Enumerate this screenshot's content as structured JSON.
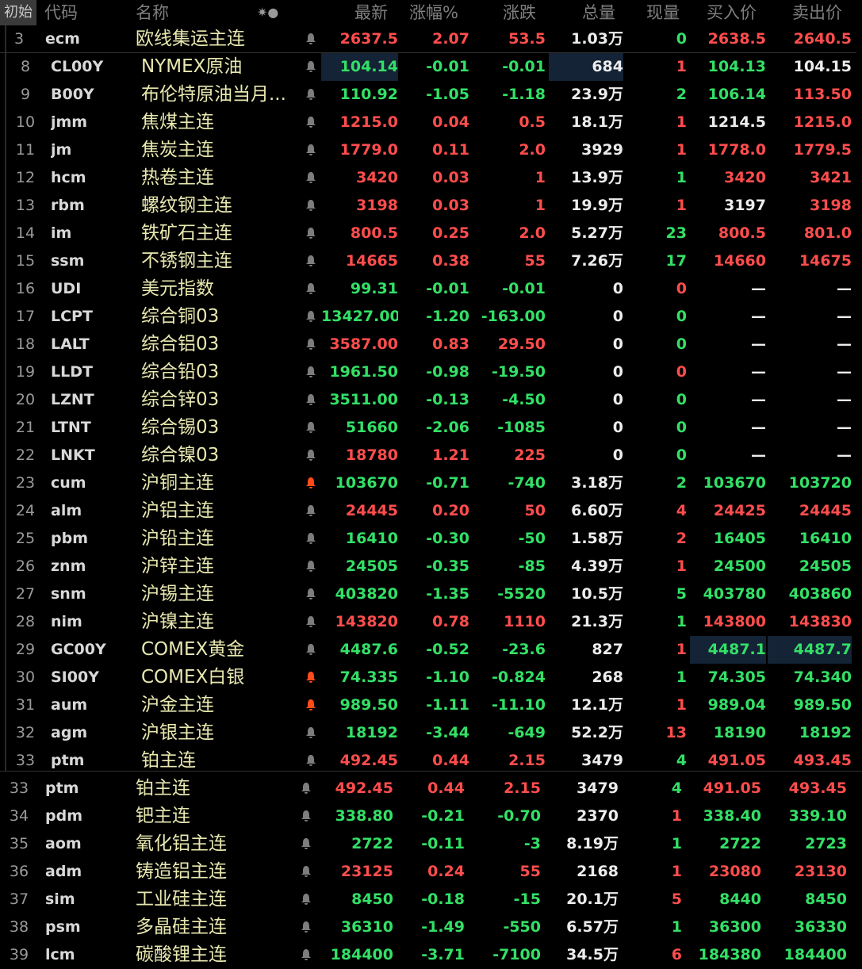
{
  "header": {
    "init": "初始",
    "code": "代码",
    "name": "名称",
    "settings": "✷●",
    "last": "最新",
    "pct": "涨幅%",
    "chg": "涨跌",
    "vol": "总量",
    "cur": "现量",
    "bid": "买入价",
    "ask": "卖出价"
  },
  "colors": {
    "up": "#ff4d4d",
    "down": "#33e066",
    "name": "#e8e8b0",
    "alert": "#ff4b1a",
    "highlight": "#142335"
  },
  "rows": [
    {
      "idx": "3",
      "code": "ecm",
      "name": "欧线集运主连",
      "last": "2637.5",
      "pct": "2.07",
      "chg": "53.5",
      "vol": "1.03万",
      "cur": "0",
      "bid": "2638.5",
      "ask": "2640.5",
      "trend": "up",
      "curColor": "green",
      "bidColor": "red",
      "askColor": "red",
      "bell": "normal"
    },
    {
      "idx": "8",
      "code": "CL00Y",
      "name": "NYMEX原油",
      "last": "104.14",
      "pct": "-0.01",
      "chg": "-0.01",
      "vol": "684",
      "cur": "1",
      "bid": "104.13",
      "ask": "104.15",
      "trend": "down",
      "curColor": "red",
      "bidColor": "green",
      "askColor": "white",
      "bell": "normal"
    },
    {
      "idx": "9",
      "code": "B00Y",
      "name": "布伦特原油当月...",
      "last": "110.92",
      "pct": "-1.05",
      "chg": "-1.18",
      "vol": "23.9万",
      "cur": "2",
      "bid": "106.14",
      "ask": "113.50",
      "trend": "down",
      "curColor": "green",
      "bidColor": "green",
      "askColor": "red",
      "bell": "normal"
    },
    {
      "idx": "10",
      "code": "jmm",
      "name": "焦煤主连",
      "last": "1215.0",
      "pct": "0.04",
      "chg": "0.5",
      "vol": "18.1万",
      "cur": "1",
      "bid": "1214.5",
      "ask": "1215.0",
      "trend": "up",
      "curColor": "red",
      "bidColor": "white",
      "askColor": "red",
      "bell": "normal"
    },
    {
      "idx": "11",
      "code": "jm",
      "name": "焦炭主连",
      "last": "1779.0",
      "pct": "0.11",
      "chg": "2.0",
      "vol": "3929",
      "cur": "1",
      "bid": "1778.0",
      "ask": "1779.5",
      "trend": "up",
      "curColor": "red",
      "bidColor": "red",
      "askColor": "red",
      "bell": "normal"
    },
    {
      "idx": "12",
      "code": "hcm",
      "name": "热卷主连",
      "last": "3420",
      "pct": "0.03",
      "chg": "1",
      "vol": "13.9万",
      "cur": "1",
      "bid": "3420",
      "ask": "3421",
      "trend": "up",
      "curColor": "green",
      "bidColor": "red",
      "askColor": "red",
      "bell": "normal"
    },
    {
      "idx": "13",
      "code": "rbm",
      "name": "螺纹钢主连",
      "last": "3198",
      "pct": "0.03",
      "chg": "1",
      "vol": "19.9万",
      "cur": "1",
      "bid": "3197",
      "ask": "3198",
      "trend": "up",
      "curColor": "red",
      "bidColor": "white",
      "askColor": "red",
      "bell": "normal"
    },
    {
      "idx": "14",
      "code": "im",
      "name": "铁矿石主连",
      "last": "800.5",
      "pct": "0.25",
      "chg": "2.0",
      "vol": "5.27万",
      "cur": "23",
      "bid": "800.5",
      "ask": "801.0",
      "trend": "up",
      "curColor": "green",
      "bidColor": "red",
      "askColor": "red",
      "bell": "normal"
    },
    {
      "idx": "15",
      "code": "ssm",
      "name": "不锈钢主连",
      "last": "14665",
      "pct": "0.38",
      "chg": "55",
      "vol": "7.26万",
      "cur": "17",
      "bid": "14660",
      "ask": "14675",
      "trend": "up",
      "curColor": "green",
      "bidColor": "red",
      "askColor": "red",
      "bell": "normal"
    },
    {
      "idx": "16",
      "code": "UDI",
      "name": "美元指数",
      "last": "99.31",
      "pct": "-0.01",
      "chg": "-0.01",
      "vol": "0",
      "cur": "0",
      "bid": "—",
      "ask": "—",
      "trend": "down",
      "curColor": "red",
      "bidColor": "white",
      "askColor": "white",
      "bell": "normal"
    },
    {
      "idx": "17",
      "code": "LCPT",
      "name": "综合铜03",
      "last": "13427.00",
      "pct": "-1.20",
      "chg": "-163.00",
      "vol": "0",
      "cur": "0",
      "bid": "—",
      "ask": "—",
      "trend": "down",
      "curColor": "green",
      "bidColor": "white",
      "askColor": "white",
      "bell": "normal"
    },
    {
      "idx": "18",
      "code": "LALT",
      "name": "综合铝03",
      "last": "3587.00",
      "pct": "0.83",
      "chg": "29.50",
      "vol": "0",
      "cur": "0",
      "bid": "—",
      "ask": "—",
      "trend": "up",
      "curColor": "green",
      "bidColor": "white",
      "askColor": "white",
      "bell": "normal"
    },
    {
      "idx": "19",
      "code": "LLDT",
      "name": "综合铅03",
      "last": "1961.50",
      "pct": "-0.98",
      "chg": "-19.50",
      "vol": "0",
      "cur": "0",
      "bid": "—",
      "ask": "—",
      "trend": "down",
      "curColor": "red",
      "bidColor": "white",
      "askColor": "white",
      "bell": "normal"
    },
    {
      "idx": "20",
      "code": "LZNT",
      "name": "综合锌03",
      "last": "3511.00",
      "pct": "-0.13",
      "chg": "-4.50",
      "vol": "0",
      "cur": "0",
      "bid": "—",
      "ask": "—",
      "trend": "down",
      "curColor": "green",
      "bidColor": "white",
      "askColor": "white",
      "bell": "normal"
    },
    {
      "idx": "21",
      "code": "LTNT",
      "name": "综合锡03",
      "last": "51660",
      "pct": "-2.06",
      "chg": "-1085",
      "vol": "0",
      "cur": "0",
      "bid": "—",
      "ask": "—",
      "trend": "down",
      "curColor": "green",
      "bidColor": "white",
      "askColor": "white",
      "bell": "normal"
    },
    {
      "idx": "22",
      "code": "LNKT",
      "name": "综合镍03",
      "last": "18780",
      "pct": "1.21",
      "chg": "225",
      "vol": "0",
      "cur": "0",
      "bid": "—",
      "ask": "—",
      "trend": "up",
      "curColor": "green",
      "bidColor": "white",
      "askColor": "white",
      "bell": "normal"
    },
    {
      "idx": "23",
      "code": "cum",
      "name": "沪铜主连",
      "last": "103670",
      "pct": "-0.71",
      "chg": "-740",
      "vol": "3.18万",
      "cur": "2",
      "bid": "103670",
      "ask": "103720",
      "trend": "down",
      "curColor": "green",
      "bidColor": "green",
      "askColor": "green",
      "bell": "alert"
    },
    {
      "idx": "24",
      "code": "alm",
      "name": "沪铝主连",
      "last": "24445",
      "pct": "0.20",
      "chg": "50",
      "vol": "6.60万",
      "cur": "4",
      "bid": "24425",
      "ask": "24445",
      "trend": "up",
      "curColor": "red",
      "bidColor": "red",
      "askColor": "red",
      "bell": "normal"
    },
    {
      "idx": "25",
      "code": "pbm",
      "name": "沪铅主连",
      "last": "16410",
      "pct": "-0.30",
      "chg": "-50",
      "vol": "1.58万",
      "cur": "2",
      "bid": "16405",
      "ask": "16410",
      "trend": "down",
      "curColor": "red",
      "bidColor": "green",
      "askColor": "green",
      "bell": "normal"
    },
    {
      "idx": "26",
      "code": "znm",
      "name": "沪锌主连",
      "last": "24505",
      "pct": "-0.35",
      "chg": "-85",
      "vol": "4.39万",
      "cur": "1",
      "bid": "24500",
      "ask": "24505",
      "trend": "down",
      "curColor": "red",
      "bidColor": "green",
      "askColor": "green",
      "bell": "normal"
    },
    {
      "idx": "27",
      "code": "snm",
      "name": "沪锡主连",
      "last": "403820",
      "pct": "-1.35",
      "chg": "-5520",
      "vol": "10.5万",
      "cur": "5",
      "bid": "403780",
      "ask": "403860",
      "trend": "down",
      "curColor": "green",
      "bidColor": "green",
      "askColor": "green",
      "bell": "normal"
    },
    {
      "idx": "28",
      "code": "nim",
      "name": "沪镍主连",
      "last": "143820",
      "pct": "0.78",
      "chg": "1110",
      "vol": "21.3万",
      "cur": "1",
      "bid": "143800",
      "ask": "143830",
      "trend": "up",
      "curColor": "green",
      "bidColor": "red",
      "askColor": "red",
      "bell": "normal"
    },
    {
      "idx": "29",
      "code": "GC00Y",
      "name": "COMEX黄金",
      "last": "4487.6",
      "pct": "-0.52",
      "chg": "-23.6",
      "vol": "827",
      "cur": "1",
      "bid": "4487.1",
      "ask": "4487.7",
      "trend": "down",
      "curColor": "red",
      "bidColor": "green",
      "askColor": "green",
      "bell": "normal"
    },
    {
      "idx": "30",
      "code": "SI00Y",
      "name": "COMEX白银",
      "last": "74.335",
      "pct": "-1.10",
      "chg": "-0.824",
      "vol": "268",
      "cur": "1",
      "bid": "74.305",
      "ask": "74.340",
      "trend": "down",
      "curColor": "green",
      "bidColor": "green",
      "askColor": "green",
      "bell": "alert"
    },
    {
      "idx": "31",
      "code": "aum",
      "name": "沪金主连",
      "last": "989.50",
      "pct": "-1.11",
      "chg": "-11.10",
      "vol": "12.1万",
      "cur": "1",
      "bid": "989.04",
      "ask": "989.50",
      "trend": "down",
      "curColor": "red",
      "bidColor": "green",
      "askColor": "green",
      "bell": "alert"
    },
    {
      "idx": "32",
      "code": "agm",
      "name": "沪银主连",
      "last": "18192",
      "pct": "-3.44",
      "chg": "-649",
      "vol": "52.2万",
      "cur": "13",
      "bid": "18190",
      "ask": "18192",
      "trend": "down",
      "curColor": "red",
      "bidColor": "green",
      "askColor": "green",
      "bell": "normal"
    },
    {
      "idx": "33",
      "code": "ptm",
      "name": "铂主连",
      "last": "492.45",
      "pct": "0.44",
      "chg": "2.15",
      "vol": "3479",
      "cur": "4",
      "bid": "491.05",
      "ask": "493.45",
      "trend": "up",
      "curColor": "green",
      "bidColor": "red",
      "askColor": "red",
      "bell": "normal"
    },
    {
      "idx": "33",
      "code": "ptm",
      "name": "铂主连",
      "last": "492.45",
      "pct": "0.44",
      "chg": "2.15",
      "vol": "3479",
      "cur": "4",
      "bid": "491.05",
      "ask": "493.45",
      "trend": "up",
      "curColor": "green",
      "bidColor": "red",
      "askColor": "red",
      "bell": "normal",
      "shift": true
    },
    {
      "idx": "34",
      "code": "pdm",
      "name": "钯主连",
      "last": "338.80",
      "pct": "-0.21",
      "chg": "-0.70",
      "vol": "2370",
      "cur": "1",
      "bid": "338.40",
      "ask": "339.10",
      "trend": "down",
      "curColor": "red",
      "bidColor": "green",
      "askColor": "green",
      "bell": "normal",
      "shift": true
    },
    {
      "idx": "35",
      "code": "aom",
      "name": "氧化铝主连",
      "last": "2722",
      "pct": "-0.11",
      "chg": "-3",
      "vol": "8.19万",
      "cur": "1",
      "bid": "2722",
      "ask": "2723",
      "trend": "down",
      "curColor": "green",
      "bidColor": "green",
      "askColor": "green",
      "bell": "normal",
      "shift": true
    },
    {
      "idx": "36",
      "code": "adm",
      "name": "铸造铝主连",
      "last": "23125",
      "pct": "0.24",
      "chg": "55",
      "vol": "2168",
      "cur": "1",
      "bid": "23080",
      "ask": "23130",
      "trend": "up",
      "curColor": "red",
      "bidColor": "red",
      "askColor": "red",
      "bell": "normal",
      "shift": true
    },
    {
      "idx": "37",
      "code": "sim",
      "name": "工业硅主连",
      "last": "8450",
      "pct": "-0.18",
      "chg": "-15",
      "vol": "20.1万",
      "cur": "5",
      "bid": "8440",
      "ask": "8450",
      "trend": "down",
      "curColor": "red",
      "bidColor": "green",
      "askColor": "green",
      "bell": "normal",
      "shift": true
    },
    {
      "idx": "38",
      "code": "psm",
      "name": "多晶硅主连",
      "last": "36310",
      "pct": "-1.49",
      "chg": "-550",
      "vol": "6.57万",
      "cur": "1",
      "bid": "36300",
      "ask": "36330",
      "trend": "down",
      "curColor": "green",
      "bidColor": "green",
      "askColor": "green",
      "bell": "normal",
      "shift": true
    },
    {
      "idx": "39",
      "code": "lcm",
      "name": "碳酸锂主连",
      "last": "184400",
      "pct": "-3.71",
      "chg": "-7100",
      "vol": "34.5万",
      "cur": "6",
      "bid": "184380",
      "ask": "184400",
      "trend": "down",
      "curColor": "red",
      "bidColor": "green",
      "askColor": "green",
      "bell": "normal",
      "shift": true
    }
  ]
}
